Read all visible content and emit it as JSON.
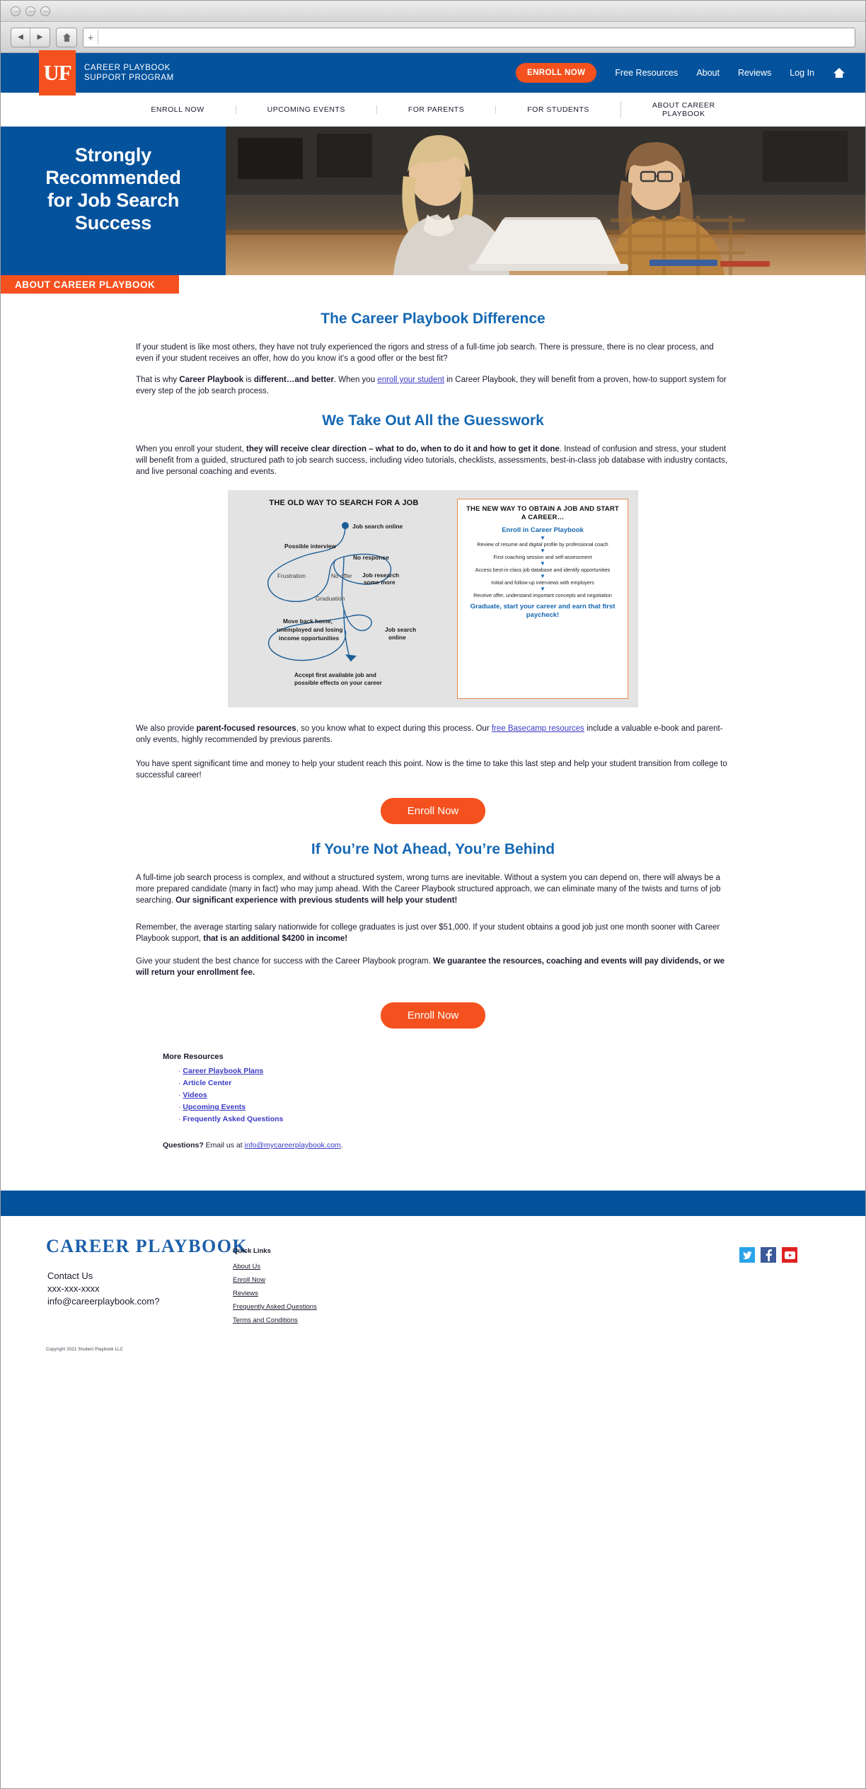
{
  "browser": {
    "url_value": "",
    "url_placeholder": "",
    "back_glyph": "◀",
    "forward_glyph": "▶",
    "plus_glyph": "+"
  },
  "header": {
    "logo_mark": "UF",
    "brand_line1": "CAREER PLAYBOOK",
    "brand_line2": "SUPPORT PROGRAM",
    "enroll_button": "ENROLL NOW",
    "links": [
      {
        "label": "Free Resources"
      },
      {
        "label": "About"
      },
      {
        "label": "Reviews"
      },
      {
        "label": "Log In"
      }
    ],
    "home_icon": "home-icon"
  },
  "subnav": {
    "items": [
      {
        "label": "ENROLL NOW"
      },
      {
        "label": "UPCOMING EVENTS"
      },
      {
        "label": "FOR PARENTS"
      },
      {
        "label": "FOR STUDENTS"
      },
      {
        "label": "ABOUT CAREER\nPLAYBOOK"
      }
    ]
  },
  "hero": {
    "title_line1": "Strongly",
    "title_line2": "Recommended",
    "title_line3": "for Job Search",
    "title_line4": "Success",
    "tag": "ABOUT CAREER PLAYBOOK"
  },
  "section1": {
    "heading": "The Career Playbook Difference",
    "p1": "If your student is like most others, they have not truly experienced the rigors and stress of a full-time job search. There is pressure, there is no clear process, and even if your student receives an offer, how do you know it’s a good offer or the best fit?",
    "p2_a": "That is why ",
    "p2_b": "Career Playbook",
    "p2_c": " is ",
    "p2_d": "different…and better",
    "p2_e": ". When you ",
    "p2_link": "enroll your student",
    "p2_f": " in Career Playbook, they will benefit from a proven, how-to support system for every step of the job search process."
  },
  "section2": {
    "heading": "We Take Out All the Guesswork",
    "p1_a": "When you enroll your student, ",
    "p1_b": "they will receive clear direction – what to do, when to do it and how to get it done",
    "p1_c": ". Instead of confusion and stress, your student will benefit from a guided, structured path to job search success, including video tutorials, checklists, assessments, best-in-class job database with industry contacts, and live personal coaching and events."
  },
  "infographic": {
    "old": {
      "title": "THE OLD WAY TO SEARCH FOR A JOB",
      "labels": [
        {
          "text": "Job search online"
        },
        {
          "text": "Possible interview"
        },
        {
          "text": "No response"
        },
        {
          "text": "Frustration"
        },
        {
          "text": "No offer"
        },
        {
          "text": "Job research\nsome more"
        },
        {
          "text": "Graduation"
        },
        {
          "text": "Move back home,\nunemployed and losing\nincome opportunities"
        },
        {
          "text": "Job search\nonline"
        },
        {
          "text": "Accept first available job and\npossible effects on your career"
        }
      ]
    },
    "new": {
      "title": "THE NEW WAY TO OBTAIN A JOB AND START A CAREER…",
      "start": "Enroll in Career Playbook",
      "steps": [
        "Review of resume and digital profile by professional coach",
        "First coaching session and self-assessment",
        "Access best-in-class job database and identify opportunities",
        "Initial and follow-up interviews with employers",
        "Receive offer, understand important concepts and negotiation"
      ],
      "end": "Graduate, start your career and earn that first paycheck!",
      "arrow_glyph": "▼"
    }
  },
  "section3": {
    "p1_a": "We also provide ",
    "p1_b": "parent-focused resources",
    "p1_c": ", so you know what to expect during this process. Our ",
    "p1_link": "free Basecamp resources",
    "p1_d": " include a valuable e-book and parent-only events, highly recommended by previous parents.",
    "p2": "You have spent significant time and money to help your student reach this point. Now is the time to take this last step and help your student transition from college to successful career!"
  },
  "cta1": {
    "label": "Enroll Now"
  },
  "section4": {
    "heading": "If You’re Not Ahead, You’re Behind",
    "p1_a": "A full-time job search process is complex, and without a structured system, wrong turns are inevitable. Without a system you can depend on, there will always be a more prepared candidate (many in fact) who may jump ahead. With the Career Playbook structured approach, we can eliminate many of the twists and turns of job searching. ",
    "p1_b": "Our significant experience with previous students will help your student!",
    "p2_a": "Remember, the average starting salary nationwide for college graduates is just over $51,000. If your student obtains a good job just one month sooner with Career Playbook support, ",
    "p2_b": "that is an additional $4200 in income!",
    "p3_a": "Give your student the best chance for success with the Career Playbook program. ",
    "p3_b": "We guarantee the resources, coaching and events will pay dividends, or we will return your enrollment fee."
  },
  "cta2": {
    "label": "Enroll Now"
  },
  "more_resources": {
    "heading": "More Resources",
    "items": [
      {
        "label": "Career Playbook Plans",
        "link": true
      },
      {
        "label": "Article Center",
        "link": false
      },
      {
        "label": "Videos",
        "link": true
      },
      {
        "label": "Upcoming Events",
        "link": true
      },
      {
        "label": "Frequently Asked Questions",
        "link": false
      }
    ],
    "questions_label": "Questions?",
    "questions_text": " Email us at ",
    "questions_email": "info@mycareerplaybook.com",
    "questions_period": "."
  },
  "footer": {
    "brand": "CAREER PLAYBOOK",
    "contact_title": "Contact Us",
    "contact_phone": "xxx-xxx-xxxx",
    "contact_email": "info@careerplaybook.com?",
    "quick_links_heading": "Quick Links",
    "quick_links": [
      {
        "label": "About Us"
      },
      {
        "label": "Enroll Now"
      },
      {
        "label": "Reviews"
      },
      {
        "label": "Frequently Asked Questions"
      },
      {
        "label": "Terms and Conditions"
      }
    ],
    "socials": [
      {
        "name": "twitter-icon",
        "color": "#2aa3e8"
      },
      {
        "name": "facebook-icon",
        "color": "#3b5998"
      },
      {
        "name": "youtube-icon",
        "color": "#e02121"
      }
    ],
    "copyright": "Copyright 2021 Student Playbook LLC"
  },
  "colors": {
    "brand_blue": "#04529c",
    "accent_orange": "#f4511e",
    "heading_blue": "#1668b3",
    "link_purple": "#3b3bc6"
  }
}
